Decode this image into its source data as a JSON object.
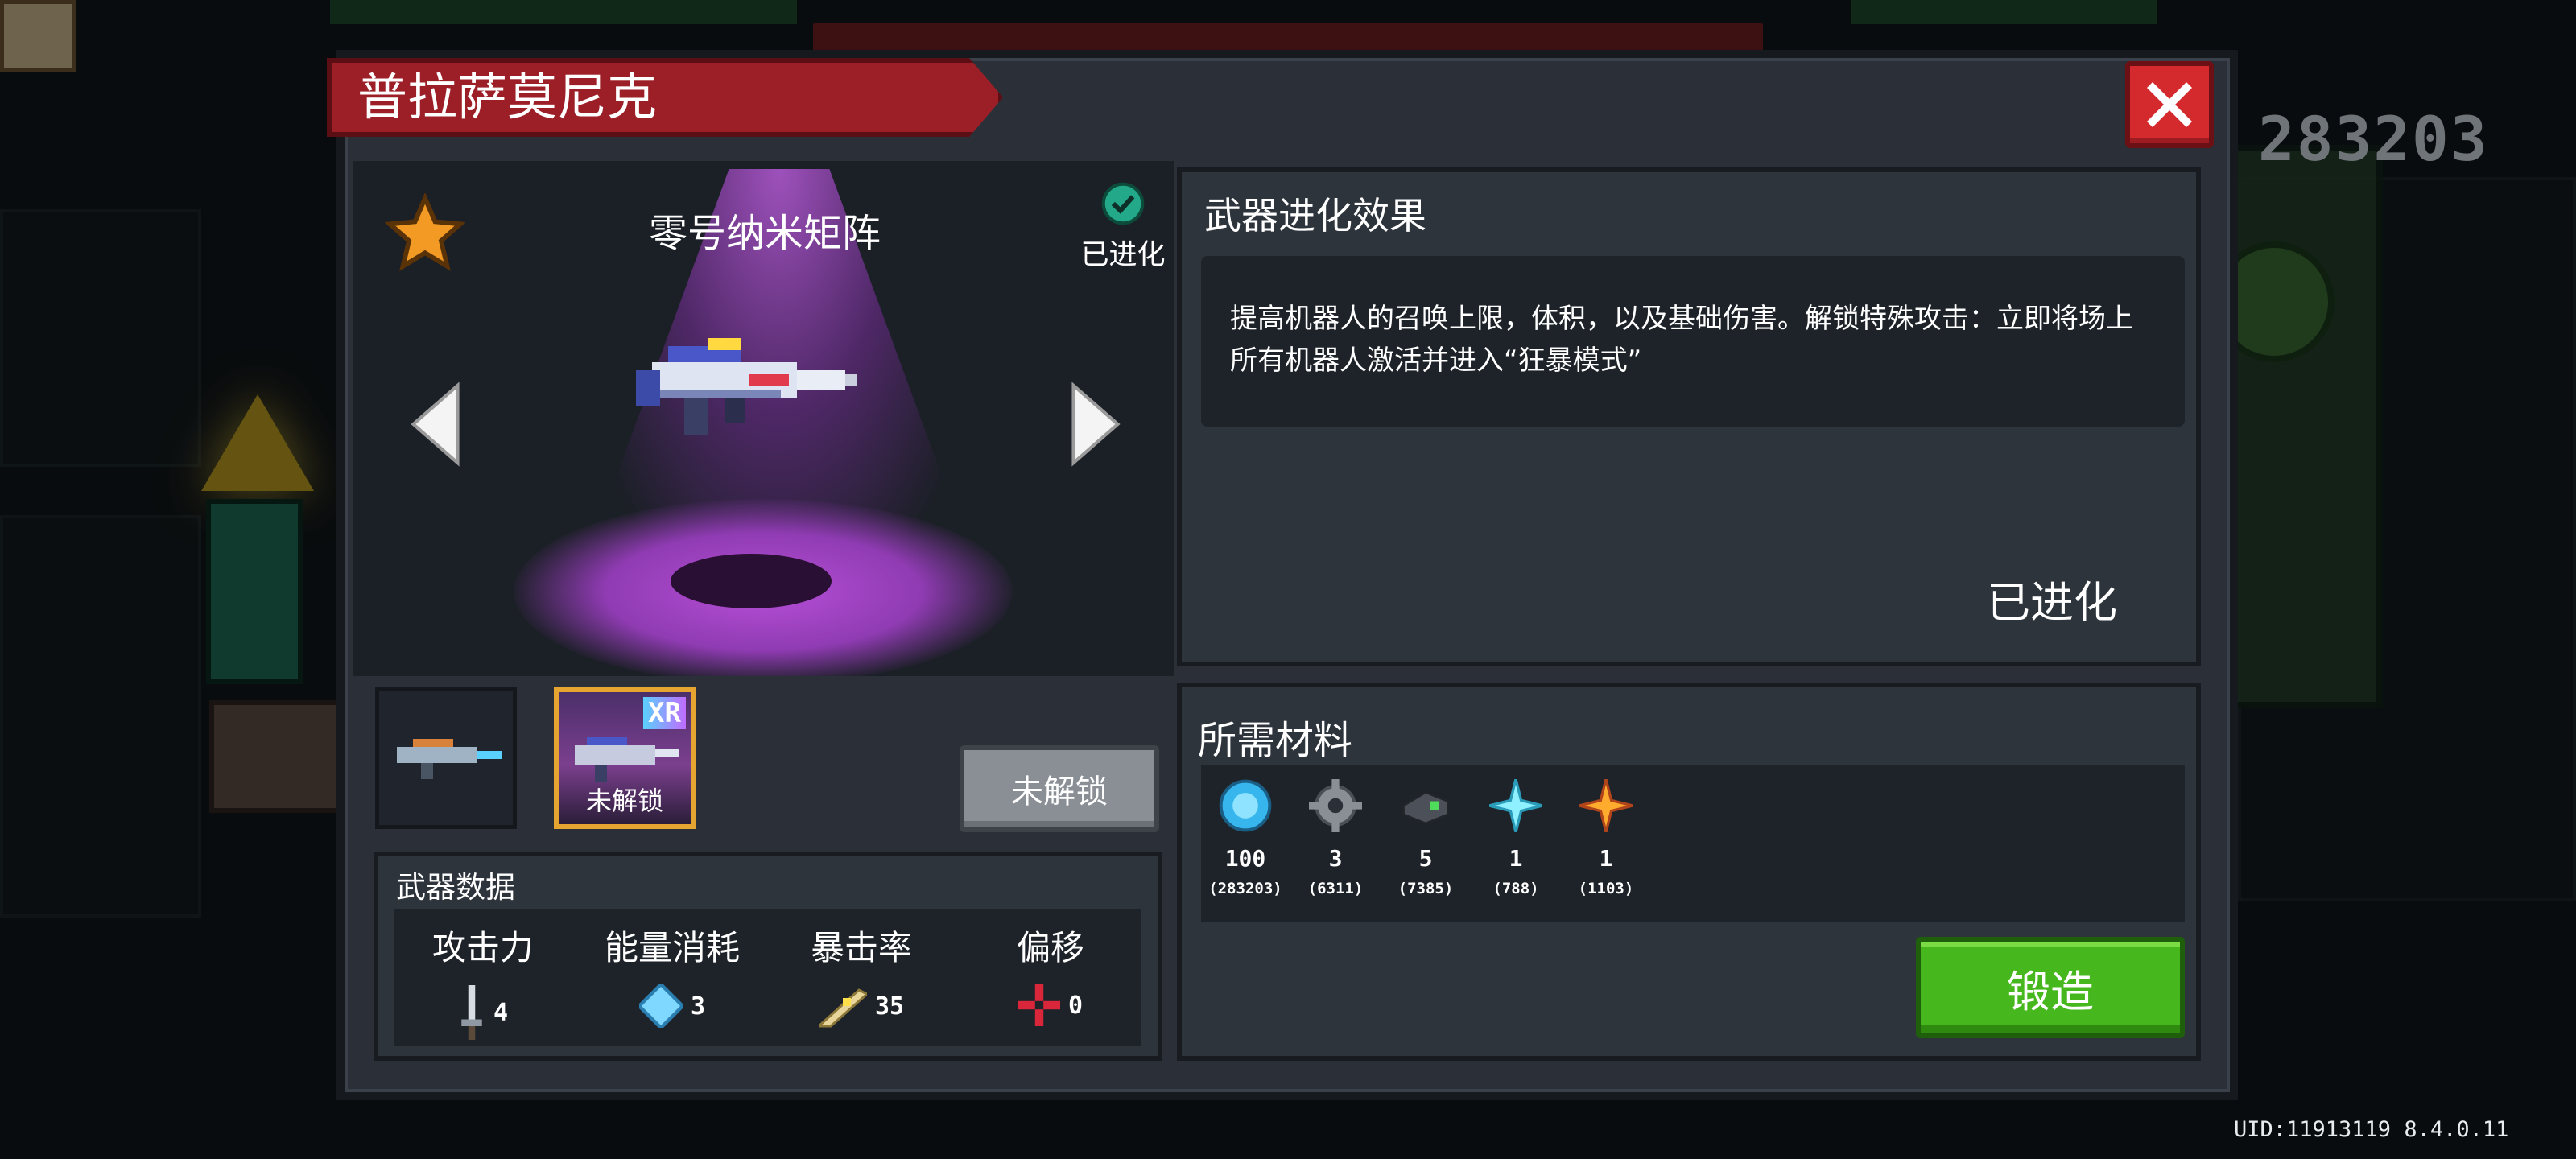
{
  "title": "普拉萨莫尼克",
  "score": "283203",
  "uid_version": "UID:11913119 8.4.0.11",
  "weapon": {
    "name": "零号纳米矩阵",
    "status_label": "已进化"
  },
  "skins": [
    {
      "caption": ""
    },
    {
      "caption": "未解锁",
      "tag": "XR"
    }
  ],
  "locked_button": "未解锁",
  "stats": {
    "title": "武器数据",
    "items": [
      {
        "label": "攻击力",
        "value": "4",
        "icon": "sword-icon"
      },
      {
        "label": "能量消耗",
        "value": "3",
        "icon": "energy-crystal-icon"
      },
      {
        "label": "暴击率",
        "value": "35",
        "icon": "crit-feather-icon"
      },
      {
        "label": "偏移",
        "value": "0",
        "icon": "crosshair-icon"
      }
    ]
  },
  "evolution": {
    "title": "武器进化效果",
    "description": "提高机器人的召唤上限，体积，以及基础伤害。解锁特殊攻击：立即将场上所有机器人激活并进入“狂暴模式”",
    "status": "已进化"
  },
  "materials": {
    "title": "所需材料",
    "items": [
      {
        "icon": "gem-coin-icon",
        "qty": "100",
        "have": "(283203)"
      },
      {
        "icon": "gear-part-icon",
        "qty": "3",
        "have": "(6311)"
      },
      {
        "icon": "battery-part-icon",
        "qty": "5",
        "have": "(7385)"
      },
      {
        "icon": "ice-crystal-icon",
        "qty": "1",
        "have": "(788)"
      },
      {
        "icon": "fire-crystal-icon",
        "qty": "1",
        "have": "(1103)"
      }
    ]
  },
  "forge_button": "锻造",
  "colors": {
    "banner": "#9c1f27",
    "forge": "#46b81d",
    "glow": "#b74fd8",
    "close": "#d42a2e"
  }
}
